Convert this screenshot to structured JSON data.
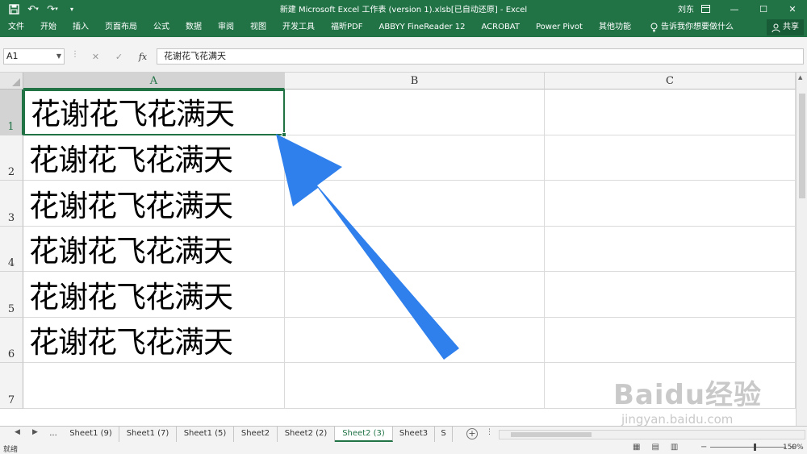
{
  "window": {
    "title": "新建 Microsoft Excel 工作表 (version 1).xlsb[已自动还原]  -  Excel",
    "user": "刘东"
  },
  "ribbon": {
    "tabs": [
      "文件",
      "开始",
      "插入",
      "页面布局",
      "公式",
      "数据",
      "审阅",
      "视图",
      "开发工具",
      "福昕PDF",
      "ABBYY FineReader 12",
      "ACROBAT",
      "Power Pivot",
      "其他功能"
    ],
    "tell_me": "告诉我你想要做什么",
    "share": "共享"
  },
  "formula_bar": {
    "name_box": "A1",
    "formula": "花谢花飞花满天"
  },
  "grid": {
    "columns": [
      "A",
      "B",
      "C"
    ],
    "rows": [
      "1",
      "2",
      "3",
      "4",
      "5",
      "6",
      "7"
    ],
    "cells": [
      "花谢花飞花满天",
      "花谢花飞花满天",
      "花谢花飞花满天",
      "花谢花飞花满天",
      "花谢花飞花满天",
      "花谢花飞花满天"
    ],
    "active_cell": "A1"
  },
  "sheets": {
    "more_left": "...",
    "tabs": [
      "Sheet1 (9)",
      "Sheet1 (7)",
      "Sheet1 (5)",
      "Sheet2",
      "Sheet2 (2)",
      "Sheet2 (3)",
      "Sheet3",
      "S"
    ],
    "active": "Sheet2 (3)"
  },
  "status": {
    "text": "就绪",
    "zoom": "150%"
  },
  "watermark": {
    "brand": "Baidu经验",
    "url": "jingyan.baidu.com"
  },
  "colors": {
    "excel_green": "#217346",
    "arrow_blue": "#2f80ed"
  }
}
